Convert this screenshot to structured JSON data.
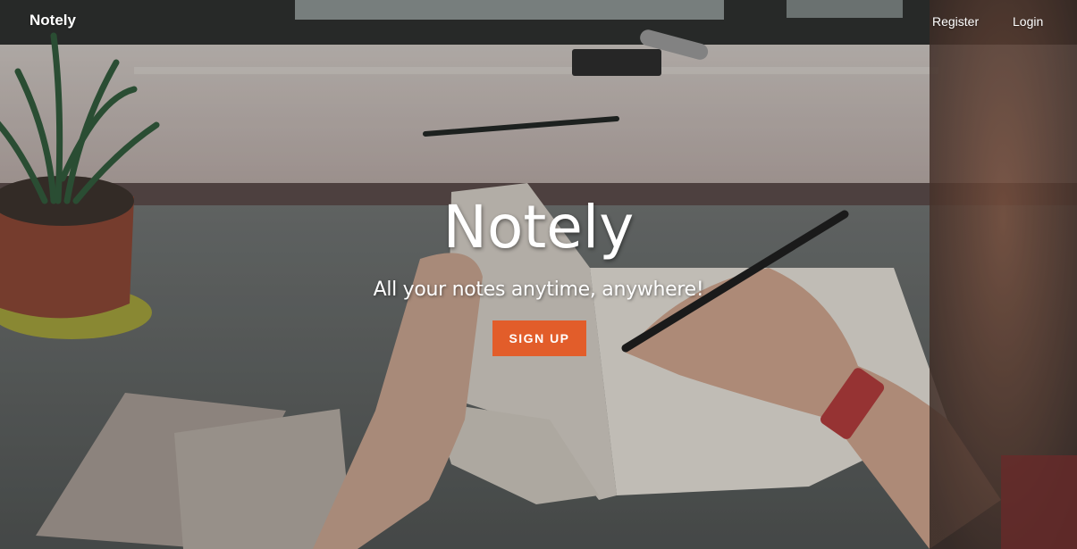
{
  "nav": {
    "brand": "Notely",
    "register_label": "Register",
    "login_label": "Login"
  },
  "hero": {
    "title": "Notely",
    "tagline": "All your notes anytime, anywhere!",
    "signup_label": "SIGN UP"
  },
  "colors": {
    "accent": "#e25d2a",
    "text": "#ffffff"
  }
}
